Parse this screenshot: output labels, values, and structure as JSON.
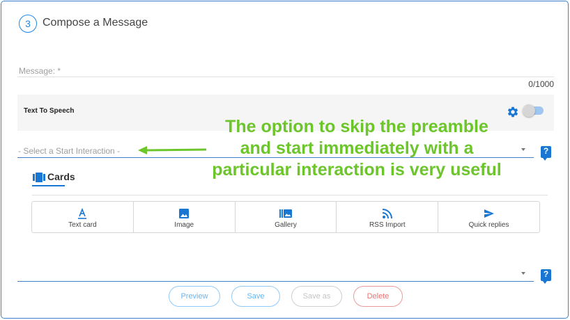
{
  "header": {
    "step_number": "3",
    "title": "Compose a Message"
  },
  "message": {
    "label": "Message: *",
    "char_count": "0/1000"
  },
  "tts": {
    "label": "Text To Speech",
    "enabled": false
  },
  "start_interaction": {
    "placeholder": "- Select a Start Interaction -",
    "help": "?"
  },
  "cards": {
    "tab_label": "Cards",
    "types": [
      {
        "label": "Text card",
        "icon": "text-card-icon"
      },
      {
        "label": "Image",
        "icon": "image-icon"
      },
      {
        "label": "Gallery",
        "icon": "gallery-icon"
      },
      {
        "label": "RSS Import",
        "icon": "rss-icon"
      },
      {
        "label": "Quick replies",
        "icon": "send-icon"
      }
    ]
  },
  "second_select": {
    "value": "",
    "help": "?"
  },
  "actions": {
    "preview": "Preview",
    "save": "Save",
    "save_as": "Save as",
    "delete": "Delete"
  },
  "annotation": {
    "lines": [
      "The option to skip the preamble",
      "and start immediately with a",
      "particular interaction is very useful"
    ]
  },
  "colors": {
    "accent": "#1976d2",
    "annotation": "#6cc52a",
    "delete": "#ef7070"
  }
}
